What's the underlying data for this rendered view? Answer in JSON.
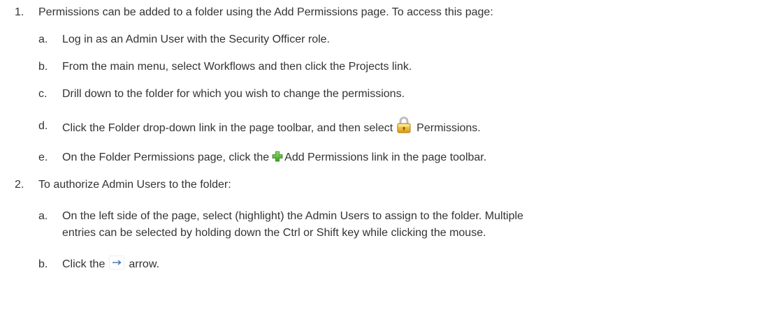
{
  "steps": [
    {
      "number": "1.",
      "text": "Permissions can be added to a folder using the Add Permissions page. To access this page:",
      "substeps": [
        {
          "letter": "a.",
          "text": "Log in as an Admin User with the Security Officer role."
        },
        {
          "letter": "b.",
          "text": "From the main menu, select Workflows and then click the Projects link."
        },
        {
          "letter": "c.",
          "text": "Drill down to the folder for which you wish to change the permissions."
        },
        {
          "letter": "d.",
          "text_before": "Click the Folder drop-down link in the page toolbar, and then select",
          "icon": "lock-icon",
          "text_after": "Permissions."
        },
        {
          "letter": "e.",
          "text_before": "On the Folder Permissions page, click the",
          "icon": "green-plus-icon",
          "text_after": "Add Permissions link in the page toolbar."
        }
      ]
    },
    {
      "number": "2.",
      "text": "To authorize Admin Users to the folder:",
      "substeps": [
        {
          "letter": "a.",
          "text_line1": "On the left side of the page, select (highlight) the Admin Users to assign to the folder. Multiple",
          "text_line2": "entries can be selected by holding down the Ctrl or Shift key while clicking the mouse."
        },
        {
          "letter": "b.",
          "text_before": "Click the",
          "icon": "right-arrow-icon",
          "text_after": "arrow."
        }
      ]
    }
  ],
  "colors": {
    "text": "#333333",
    "lock_gold": "#e8b420",
    "plus_green": "#4caf3a",
    "arrow_blue": "#3a6fb0"
  }
}
